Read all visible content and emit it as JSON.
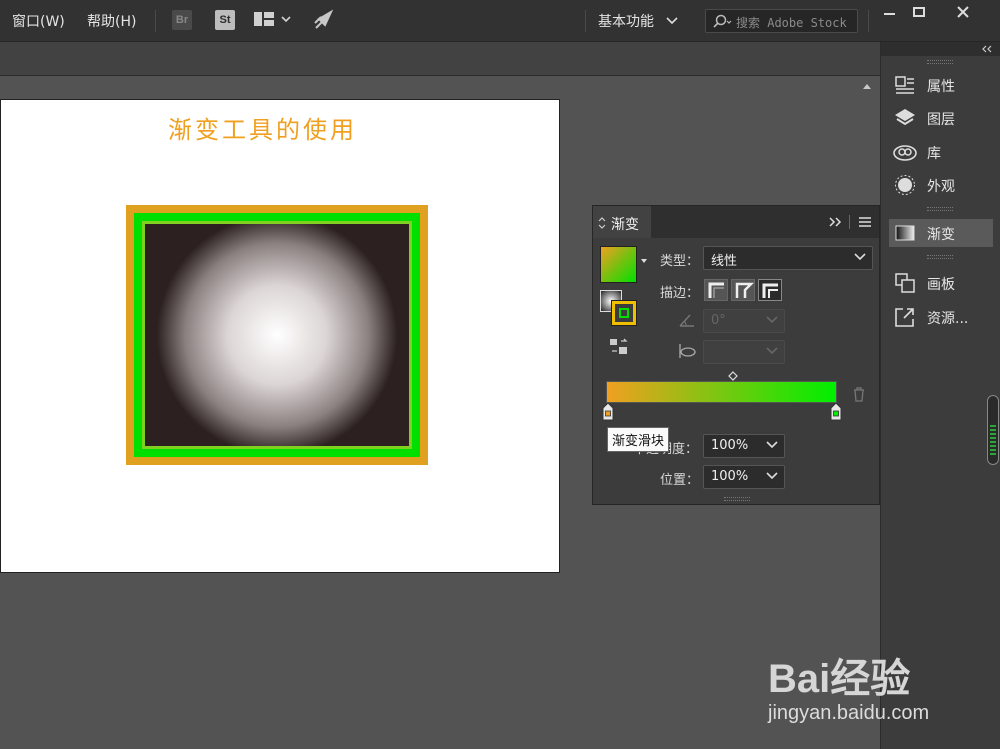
{
  "menubar": {
    "items": [
      "窗口(W)",
      "帮助(H)"
    ],
    "bridge_badge": "Br",
    "stock_badge": "St",
    "workspace": "基本功能",
    "search_placeholder": "搜索 Adobe Stock"
  },
  "artboard": {
    "title": "渐变工具的使用"
  },
  "dock": {
    "items": [
      {
        "label": "属性",
        "icon": "properties-icon"
      },
      {
        "label": "图层",
        "icon": "layers-icon"
      },
      {
        "label": "库",
        "icon": "libraries-icon"
      },
      {
        "label": "外观",
        "icon": "appearance-icon"
      },
      {
        "label": "渐变",
        "icon": "gradient-icon",
        "active": true
      },
      {
        "label": "画板",
        "icon": "artboards-icon"
      },
      {
        "label": "资源...",
        "icon": "asset-export-icon"
      }
    ]
  },
  "gradient_panel": {
    "tab": "渐变",
    "type_label": "类型：",
    "type_value": "线性",
    "stroke_label": "描边：",
    "angle_value": "0°",
    "opacity_label": "不透明度：",
    "opacity_value": "100%",
    "location_label": "位置：",
    "location_value": "100%",
    "tooltip": "渐变滑块",
    "start_color": "#f0a020",
    "end_color": "#00ef00"
  },
  "watermark": {
    "logo": "Bai经验",
    "url": "jingyan.baidu.com"
  }
}
